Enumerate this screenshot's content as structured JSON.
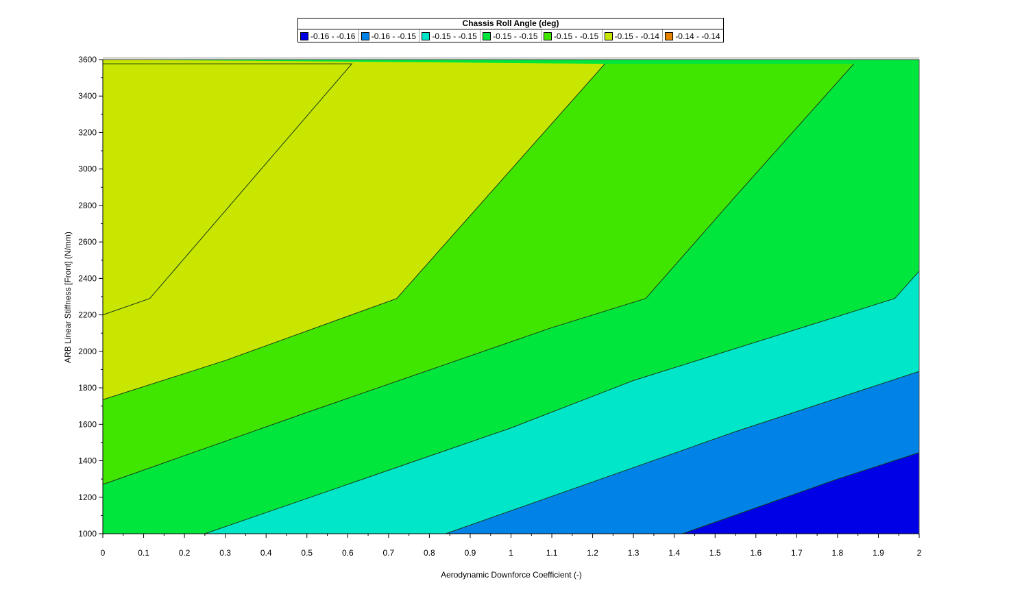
{
  "chart_data": {
    "type": "contour",
    "title": "Chassis Roll Angle (deg)",
    "xlabel": "Aerodynamic Downforce Coefficient (-)",
    "ylabel": "ARB Linear Stiffness [Front] (N/mm)",
    "xlim": [
      0,
      2
    ],
    "ylim": [
      1000,
      3600
    ],
    "x_ticks": [
      "0",
      "0.1",
      "0.2",
      "0.3",
      "0.4",
      "0.5",
      "0.6",
      "0.7",
      "0.8",
      "0.9",
      "1",
      "1.1",
      "1.2",
      "1.3",
      "1.4",
      "1.5",
      "1.6",
      "1.7",
      "1.8",
      "1.9",
      "2"
    ],
    "y_ticks": [
      "1000",
      "1200",
      "1400",
      "1600",
      "1800",
      "2000",
      "2200",
      "2400",
      "2600",
      "2800",
      "3000",
      "3200",
      "3400",
      "3600"
    ],
    "legend": {
      "placement": "top",
      "entries": [
        {
          "label": "-0.16 - -0.16",
          "color": "#0000e6"
        },
        {
          "label": "-0.16 - -0.15",
          "color": "#0082e6"
        },
        {
          "label": "-0.15 - -0.15",
          "color": "#00e6c8"
        },
        {
          "label": "-0.15 - -0.15",
          "color": "#00e63c"
        },
        {
          "label": "-0.15 - -0.15",
          "color": "#40e600"
        },
        {
          "label": "-0.15 - -0.14",
          "color": "#c8e600"
        },
        {
          "label": "-0.14 - -0.14",
          "color": "#e68200"
        }
      ]
    },
    "contour_lines": [
      {
        "band_above": 5,
        "points": [
          [
            0,
            3577
          ],
          [
            0.61,
            3577
          ],
          [
            0.115,
            2290
          ],
          [
            0,
            2200
          ]
        ]
      },
      {
        "band_above": 4,
        "points": [
          [
            0,
            1735
          ],
          [
            0.3,
            1950
          ],
          [
            0.72,
            2290
          ],
          [
            1.23,
            3577
          ]
        ]
      },
      {
        "band_above": 3,
        "points": [
          [
            0,
            1270
          ],
          [
            0.5,
            1665
          ],
          [
            1.1,
            2130
          ],
          [
            1.33,
            2290
          ],
          [
            1.55,
            2850
          ],
          [
            1.84,
            3577
          ]
        ]
      },
      {
        "band_above": 2,
        "points": [
          [
            0.25,
            1000
          ],
          [
            1,
            1580
          ],
          [
            1.3,
            1840
          ],
          [
            1.94,
            2290
          ],
          [
            2,
            2440
          ]
        ]
      },
      {
        "band_above": 1,
        "points": [
          [
            0.84,
            1000
          ],
          [
            1.55,
            1560
          ],
          [
            2,
            1890
          ]
        ]
      },
      {
        "band_above": 0,
        "points": [
          [
            1.42,
            1000
          ],
          [
            1.8,
            1300
          ],
          [
            2,
            1445
          ]
        ]
      }
    ]
  }
}
